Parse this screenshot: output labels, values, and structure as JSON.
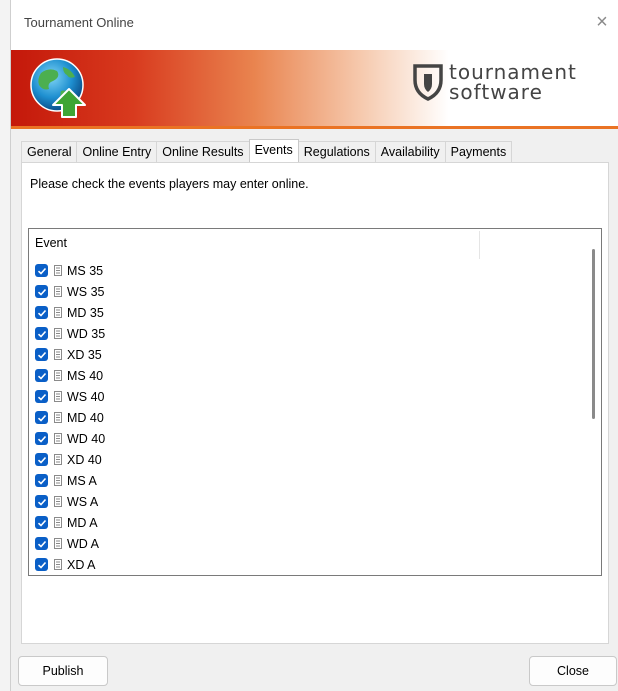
{
  "window": {
    "title": "Tournament Online",
    "close_glyph": "×"
  },
  "banner": {
    "logo_icon": "globe-upload-icon",
    "brand_line1": "tournament",
    "brand_line2": "software",
    "colors": {
      "red": "#c4180a",
      "orange": "#ea7324",
      "shield": "#444444"
    }
  },
  "tabs": [
    {
      "label": "General",
      "active": false
    },
    {
      "label": "Online Entry",
      "active": false
    },
    {
      "label": "Online Results",
      "active": false
    },
    {
      "label": "Events",
      "active": true
    },
    {
      "label": "Regulations",
      "active": false
    },
    {
      "label": "Availability",
      "active": false
    },
    {
      "label": "Payments",
      "active": false
    }
  ],
  "events_panel": {
    "instruction": "Please check the events players may enter online.",
    "column_header": "Event",
    "rows": [
      {
        "label": "MS 35",
        "checked": true
      },
      {
        "label": "WS 35",
        "checked": true
      },
      {
        "label": "MD 35",
        "checked": true
      },
      {
        "label": "WD 35",
        "checked": true
      },
      {
        "label": "XD 35",
        "checked": true
      },
      {
        "label": "MS 40",
        "checked": true
      },
      {
        "label": "WS 40",
        "checked": true
      },
      {
        "label": "MD 40",
        "checked": true
      },
      {
        "label": "WD 40",
        "checked": true
      },
      {
        "label": "XD 40",
        "checked": true
      },
      {
        "label": "MS A",
        "checked": true
      },
      {
        "label": "WS A",
        "checked": true
      },
      {
        "label": "MD A",
        "checked": true
      },
      {
        "label": "WD A",
        "checked": true
      },
      {
        "label": "XD A",
        "checked": true
      }
    ]
  },
  "buttons": {
    "publish": "Publish",
    "close": "Close"
  },
  "accent_color": "#0a5fc7"
}
